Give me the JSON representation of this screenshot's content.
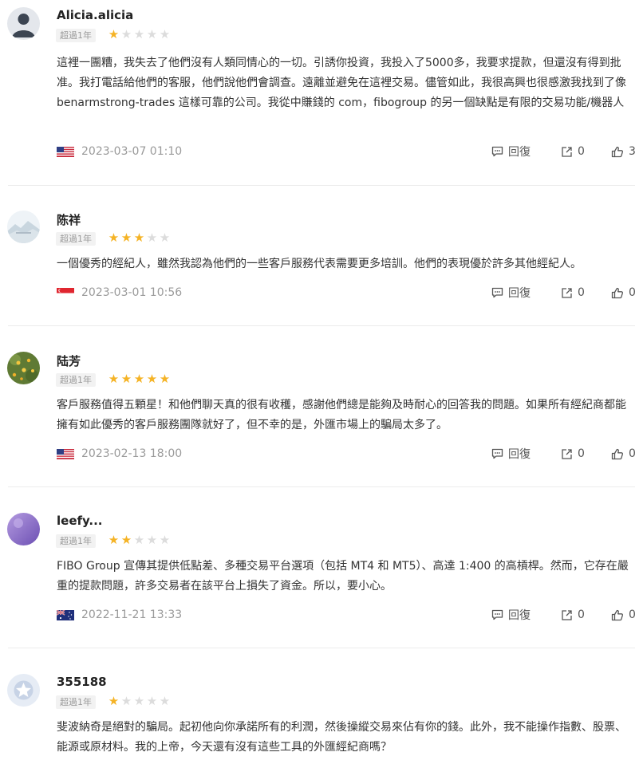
{
  "reviews": [
    {
      "username": "Alicia.alicia",
      "tenure": "超過1年",
      "rating": 1,
      "body": "這裡一團糟，我失去了他們沒有人類同情心的一切。引誘你投資，我投入了5000多，我要求提款，但還沒有得到批准。我打電話給他們的客服，他們說他們會調查。遠離並避免在這裡交易。儘管如此，我很高興也很感激我找到了像 benarmstrong-trades 這樣可靠的公司。我從中賺錢的 com，fibogroup 的另一個缺點是有限的交易功能/機器人",
      "flag": "us-flag-icon",
      "date": "2023-03-07 01:10",
      "reply_label": "回復",
      "share_count": "0",
      "like_count": "3",
      "avatar": "default-user-avatar"
    },
    {
      "username": "陈祥",
      "tenure": "超過1年",
      "rating": 3,
      "body": "一個優秀的經紀人，雖然我認為他們的一些客戶服務代表需要更多培訓。他們的表現優於許多其他經紀人。",
      "flag": "sg-flag-icon",
      "date": "2023-03-01 10:56",
      "reply_label": "回復",
      "share_count": "0",
      "like_count": "0",
      "avatar": "landscape-avatar"
    },
    {
      "username": "陆芳",
      "tenure": "超過1年",
      "rating": 5,
      "body": "客戶服務值得五顆星！和他們聊天真的很有收穫，感謝他們總是能夠及時耐心的回答我的問題。如果所有經紀商都能擁有如此優秀的客戶服務團隊就好了，但不幸的是，外匯市場上的騙局太多了。",
      "flag": "us-flag-icon",
      "date": "2023-02-13 18:00",
      "reply_label": "回復",
      "share_count": "0",
      "like_count": "0",
      "avatar": "flower-avatar"
    },
    {
      "username": "leefy...",
      "tenure": "超過1年",
      "rating": 2,
      "body": "FIBO Group 宣傳其提供低點差、多種交易平台選項（包括 MT4 和 MT5）、高達 1:400 的高槓桿。然而，它存在嚴重的提款問題，許多交易者在該平台上損失了資金。所以，要小心。",
      "flag": "au-flag-icon",
      "date": "2022-11-21 13:33",
      "reply_label": "回復",
      "share_count": "0",
      "like_count": "0",
      "avatar": "purple-avatar"
    },
    {
      "username": "355188",
      "tenure": "超過1年",
      "rating": 1,
      "body": "斐波納奇是絕對的騙局。起初他向你承諾所有的利潤，然後操縱交易來佔有你的錢。此外，我不能操作指數、股票、能源或原材料。我的上帝，今天還有沒有這些工具的外匯經紀商嗎？",
      "avatar": "star-badge-avatar"
    }
  ],
  "colors": {
    "star_on": "#f5b325",
    "star_off": "#dcdcdc",
    "muted_text": "#9a9a9a",
    "divider": "#ececec"
  }
}
